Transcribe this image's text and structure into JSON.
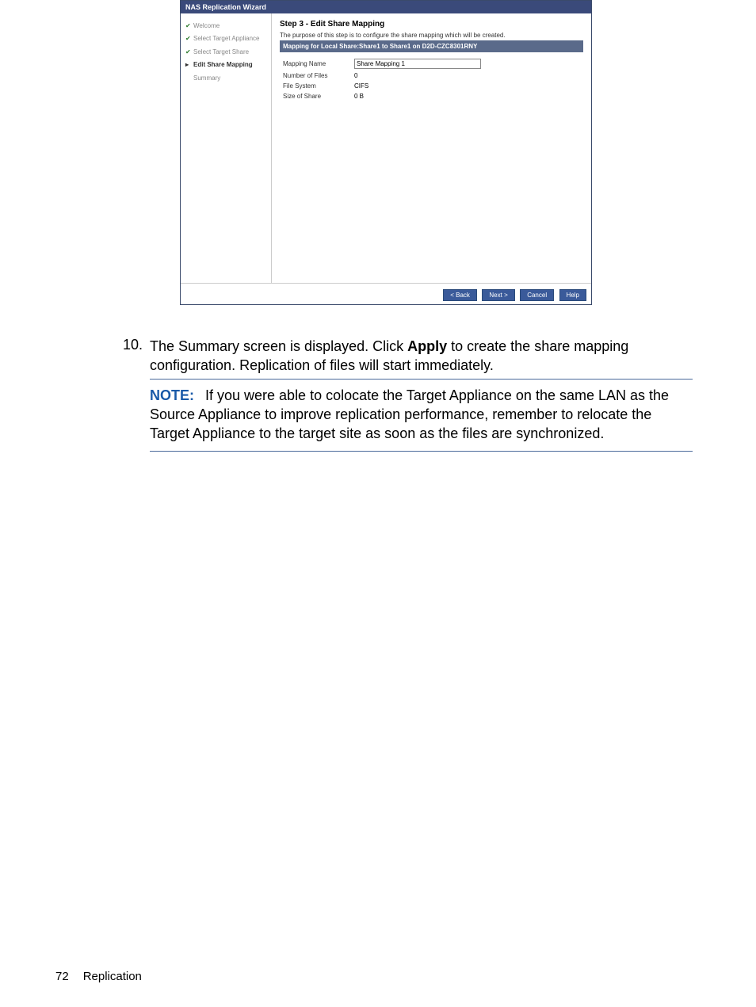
{
  "wizard": {
    "title": "NAS Replication Wizard",
    "steps": [
      {
        "label": "Welcome",
        "state": "done"
      },
      {
        "label": "Select Target Appliance",
        "state": "done"
      },
      {
        "label": "Select Target Share",
        "state": "done"
      },
      {
        "label": "Edit Share Mapping",
        "state": "current"
      },
      {
        "label": "Summary",
        "state": "pending"
      }
    ],
    "main": {
      "step_title": "Step 3 - Edit Share Mapping",
      "step_desc": "The purpose of this step is to configure the share mapping which will be created.",
      "mapping_header": "Mapping for Local Share:Share1 to Share1 on D2D-CZC8301RNY",
      "properties": {
        "mapping_name_label": "Mapping Name",
        "mapping_name_value": "Share Mapping 1",
        "num_files_label": "Number of Files",
        "num_files_value": "0",
        "file_system_label": "File System",
        "file_system_value": "CIFS",
        "size_of_share_label": "Size of Share",
        "size_of_share_value": "0 B"
      }
    },
    "buttons": {
      "back": "< Back",
      "next": "Next >",
      "cancel": "Cancel",
      "help": "Help"
    }
  },
  "instruction": {
    "number": "10.",
    "text_prefix": "The Summary screen is displayed. Click ",
    "text_bold": "Apply",
    "text_suffix": " to create the share mapping configuration. Replication of files will start immediately."
  },
  "note": {
    "label": "NOTE:",
    "text": "If you were able to colocate the Target Appliance on the same LAN as the Source Appliance to improve replication performance, remember to relocate the Target Appliance to the target site as soon as the files are synchronized."
  },
  "footer": {
    "page_number": "72",
    "section": "Replication"
  }
}
